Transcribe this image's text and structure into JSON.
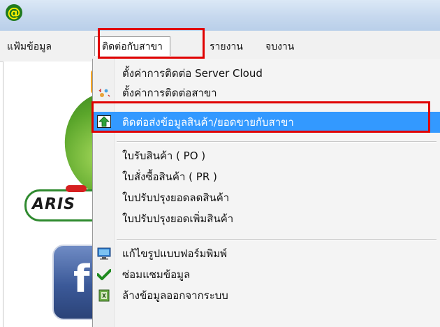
{
  "titlebar": {
    "icon_glyph": "@",
    "icon_name": "at-sign-icon"
  },
  "menubar": {
    "items": [
      {
        "label": "แฟ้มข้อมูล"
      },
      {
        "label": "ติดต่อกับสาขา"
      },
      {
        "label": "รายงาน"
      },
      {
        "label": "จบงาน"
      }
    ]
  },
  "background": {
    "badge_text": "ARIS",
    "fb_letter": "f"
  },
  "dropdown": {
    "items": [
      {
        "label": "ตั้งค่าการติดต่อ Server Cloud",
        "icon": ""
      },
      {
        "label": "ตั้งค่าการติดต่อสาขา",
        "icon": "sparkle-settings-icon"
      },
      {
        "label": "ติดต่อส่งข้อมูลสินค้า/ยอดขายกับสาขา",
        "icon": "upload-arrow-icon",
        "selected": true
      },
      {
        "label": "ใบรับสินค้า ( PO )",
        "icon": ""
      },
      {
        "label": "ใบสั่งซื้อสินค้า ( PR )",
        "icon": ""
      },
      {
        "label": "ใบปรับปรุงยอดลดสินค้า",
        "icon": ""
      },
      {
        "label": "ใบปรับปรุงยอดเพิ่มสินค้า",
        "icon": ""
      },
      {
        "label": "แก้ไขรูปแบบฟอร์มพิมพ์",
        "icon": "monitor-icon"
      },
      {
        "label": "ซ่อมแซมข้อมูล",
        "icon": "checkmark-icon"
      },
      {
        "label": "ล้างข้อมูลออกจากระบบ",
        "icon": "clear-data-icon"
      }
    ]
  },
  "colors": {
    "highlight": "#e00000",
    "selection": "#3399ff"
  }
}
